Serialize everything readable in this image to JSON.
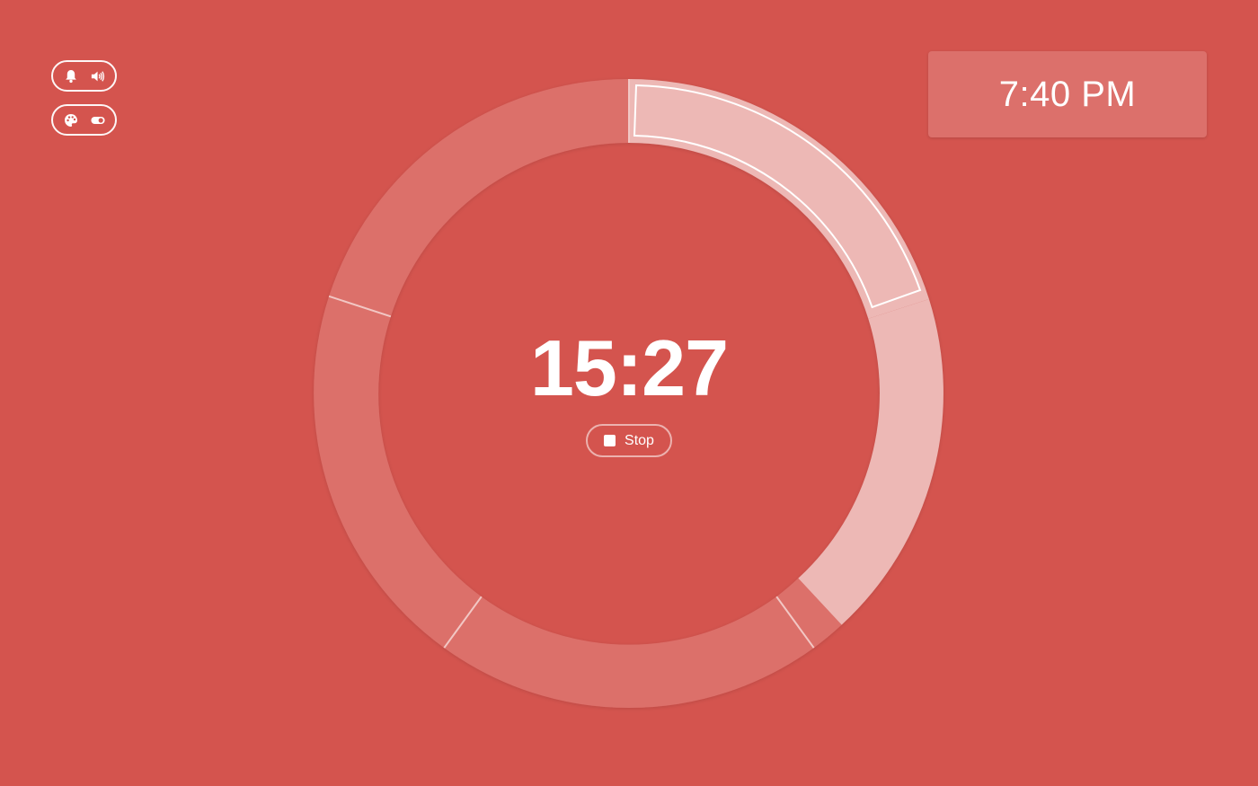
{
  "controls": {
    "top_pill": {
      "icons": [
        "bell-icon",
        "speaker-icon"
      ]
    },
    "bottom_pill": {
      "icons": [
        "palette-icon",
        "toggle-icon"
      ]
    }
  },
  "clock": {
    "time": "7:40 PM"
  },
  "timer": {
    "remaining": "15:27",
    "stop_label": "Stop"
  },
  "colors": {
    "background": "#d4544e",
    "ring_segment": "#dc706b",
    "ring_active": "#edb8b5",
    "text": "#ffffff"
  }
}
